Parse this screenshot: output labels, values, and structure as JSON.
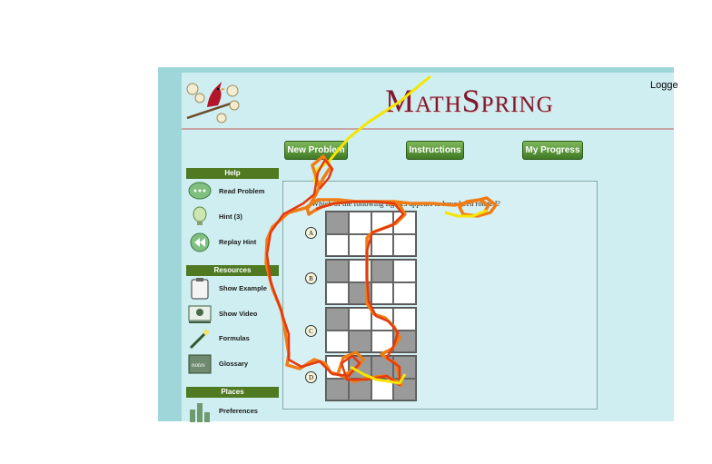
{
  "header": {
    "logo_text": "MathSpring",
    "logged_text": "Logge"
  },
  "toolbar": {
    "new_problem": "New Problem",
    "instructions": "Instructions",
    "my_progress": "My Progress"
  },
  "sidebar": {
    "help_title": "Help",
    "help_items": [
      "Read Problem",
      "Hint (3)",
      "Replay Hint"
    ],
    "resources_title": "Resources",
    "resource_items": [
      "Show Example",
      "Show Video",
      "Formulas",
      "Glossary"
    ],
    "places_title": "Places",
    "place_items": [
      "Preferences"
    ]
  },
  "problem": {
    "question": "Which of the following figures appears to have been rotated?",
    "options": [
      "A",
      "B",
      "C",
      "D"
    ]
  },
  "colors": {
    "accent": "#4f7a22",
    "logo": "#7a1a30",
    "background": "#cfeef1"
  }
}
